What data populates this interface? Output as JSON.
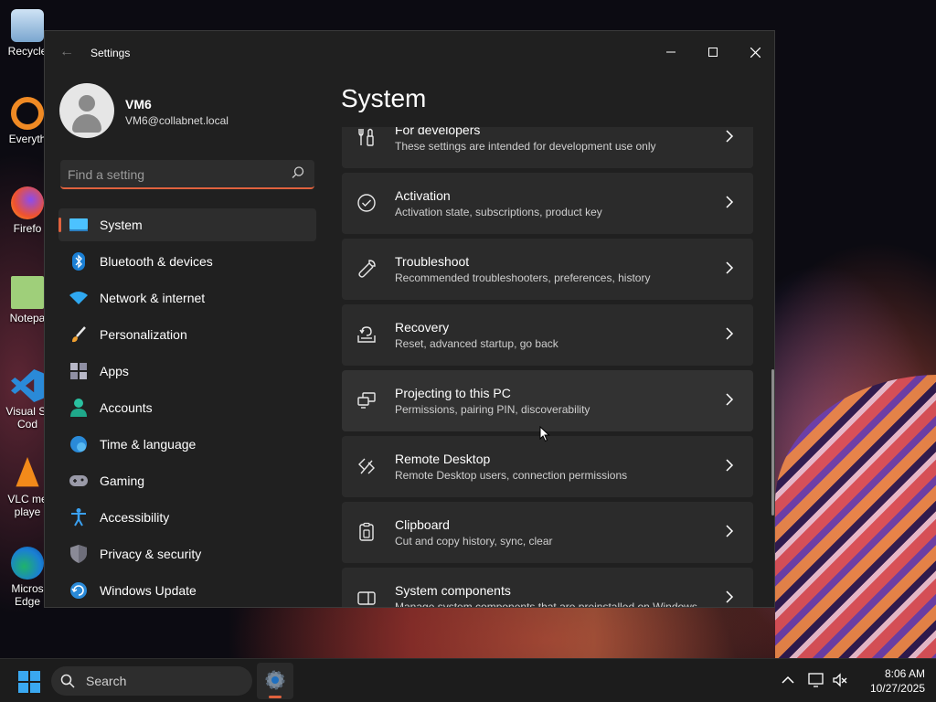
{
  "desktop": {
    "icons": [
      {
        "label": "Recycle"
      },
      {
        "label": "Everyth"
      },
      {
        "label": "Firefo"
      },
      {
        "label": "Notepa"
      },
      {
        "label": "Visual St Cod"
      },
      {
        "label": "VLC me playe"
      },
      {
        "label": "Micros Edge"
      }
    ]
  },
  "window": {
    "title": "Settings",
    "back_icon": "back-arrow-icon"
  },
  "profile": {
    "name": "VM6",
    "email": "VM6@collabnet.local"
  },
  "search": {
    "placeholder": "Find a setting",
    "value": ""
  },
  "nav": {
    "items": [
      {
        "label": "System",
        "icon": "system-icon",
        "active": true
      },
      {
        "label": "Bluetooth & devices",
        "icon": "bluetooth-icon"
      },
      {
        "label": "Network & internet",
        "icon": "wifi-icon"
      },
      {
        "label": "Personalization",
        "icon": "brush-icon"
      },
      {
        "label": "Apps",
        "icon": "apps-icon"
      },
      {
        "label": "Accounts",
        "icon": "accounts-icon"
      },
      {
        "label": "Time & language",
        "icon": "globe-icon"
      },
      {
        "label": "Gaming",
        "icon": "gamepad-icon"
      },
      {
        "label": "Accessibility",
        "icon": "accessibility-icon"
      },
      {
        "label": "Privacy & security",
        "icon": "shield-icon"
      },
      {
        "label": "Windows Update",
        "icon": "update-icon"
      }
    ]
  },
  "main": {
    "title": "System",
    "cards": [
      {
        "title": "For developers",
        "subtitle": "These settings are intended for development use only",
        "icon": "developer-tools-icon"
      },
      {
        "title": "Activation",
        "subtitle": "Activation state, subscriptions, product key",
        "icon": "check-circle-icon"
      },
      {
        "title": "Troubleshoot",
        "subtitle": "Recommended troubleshooters, preferences, history",
        "icon": "wrench-icon"
      },
      {
        "title": "Recovery",
        "subtitle": "Reset, advanced startup, go back",
        "icon": "recovery-icon"
      },
      {
        "title": "Projecting to this PC",
        "subtitle": "Permissions, pairing PIN, discoverability",
        "icon": "projecting-icon"
      },
      {
        "title": "Remote Desktop",
        "subtitle": "Remote Desktop users, connection permissions",
        "icon": "remote-desktop-icon"
      },
      {
        "title": "Clipboard",
        "subtitle": "Cut and copy history, sync, clear",
        "icon": "clipboard-icon"
      },
      {
        "title": "System components",
        "subtitle": "Manage system components that are preinstalled on Windows",
        "icon": "system-components-icon"
      }
    ]
  },
  "taskbar": {
    "search_label": "Search",
    "time": "8:06 AM",
    "date": "10/27/2025"
  },
  "colors": {
    "accent": "#e0623e",
    "window_bg": "#202020",
    "card_bg": "#2b2b2b"
  }
}
